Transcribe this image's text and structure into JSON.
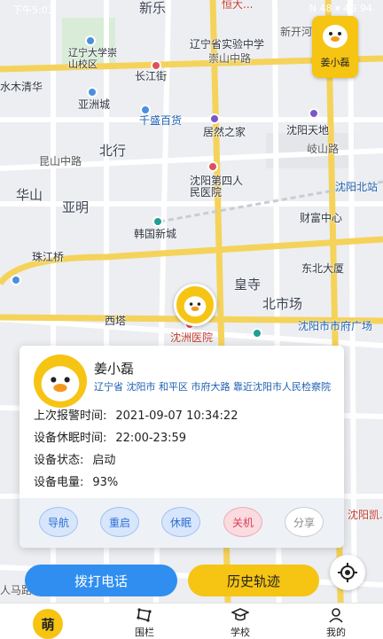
{
  "status_bar": {
    "time": "下午5:03",
    "right": "N 48 ▾ 4G 94"
  },
  "map": {
    "labels": [
      {
        "text": "新乐",
        "cls": "big"
      },
      {
        "text": "恒大...",
        "cls": "red"
      },
      {
        "text": "新开河",
        "cls": "road"
      },
      {
        "text": "辽宁省实验中学",
        "cls": ""
      },
      {
        "text": "崇山中路",
        "cls": "road"
      },
      {
        "text": "辽宁大学崇山校区",
        "cls": ""
      },
      {
        "text": "水木清华",
        "cls": ""
      },
      {
        "text": "长江街",
        "cls": ""
      },
      {
        "text": "亚洲城",
        "cls": ""
      },
      {
        "text": "千盛百货",
        "cls": "blue"
      },
      {
        "text": "居然之家",
        "cls": ""
      },
      {
        "text": "沈阳天地",
        "cls": ""
      },
      {
        "text": "岐山路",
        "cls": "road"
      },
      {
        "text": "北行",
        "cls": "big"
      },
      {
        "text": "昆山中路",
        "cls": "road"
      },
      {
        "text": "华山",
        "cls": "big"
      },
      {
        "text": "亚明",
        "cls": "big"
      },
      {
        "text": "沈阳第四人民医院",
        "cls": ""
      },
      {
        "text": "沈阳北站",
        "cls": "blue"
      },
      {
        "text": "财富中心",
        "cls": ""
      },
      {
        "text": "韩国新城",
        "cls": ""
      },
      {
        "text": "珠江桥",
        "cls": ""
      },
      {
        "text": "东北大厦",
        "cls": ""
      },
      {
        "text": "皇寺",
        "cls": "big"
      },
      {
        "text": "北市场",
        "cls": "big"
      },
      {
        "text": "西塔",
        "cls": ""
      },
      {
        "text": "沈洲医院",
        "cls": "red"
      },
      {
        "text": "沈阳市市府广场",
        "cls": "blue"
      },
      {
        "text": "人马路",
        "cls": "road"
      },
      {
        "text": "沈阳凯...",
        "cls": "red"
      }
    ]
  },
  "user_chip": {
    "name": "姜小磊"
  },
  "card": {
    "name": "姜小磊",
    "address": "辽宁省 沈阳市 和平区 市府大路 靠近沈阳市人民检察院",
    "rows": [
      {
        "key": "上次报警时间:",
        "value": "2021-09-07 10:34:22"
      },
      {
        "key": "设备休眠时间:",
        "value": "22:00-23:59"
      },
      {
        "key": "设备状态:",
        "value": "启动"
      },
      {
        "key": "设备电量:",
        "value": "93%"
      }
    ],
    "actions": [
      {
        "label": "导航",
        "style": "blue"
      },
      {
        "label": "重启",
        "style": "blue"
      },
      {
        "label": "休眠",
        "style": "blue"
      },
      {
        "label": "关机",
        "style": "red"
      },
      {
        "label": "分享",
        "style": "gray"
      }
    ]
  },
  "buttons": {
    "call": "拨打电话",
    "history": "历史轨迹"
  },
  "tabbar": {
    "home": "萌",
    "tabs": [
      {
        "label": "围栏",
        "icon": "fence-icon"
      },
      {
        "label": "学校",
        "icon": "school-icon"
      },
      {
        "label": "我的",
        "icon": "person-icon"
      }
    ]
  },
  "colors": {
    "accent": "#f6c413",
    "primary": "#2f8ef0",
    "danger": "#d94057"
  }
}
